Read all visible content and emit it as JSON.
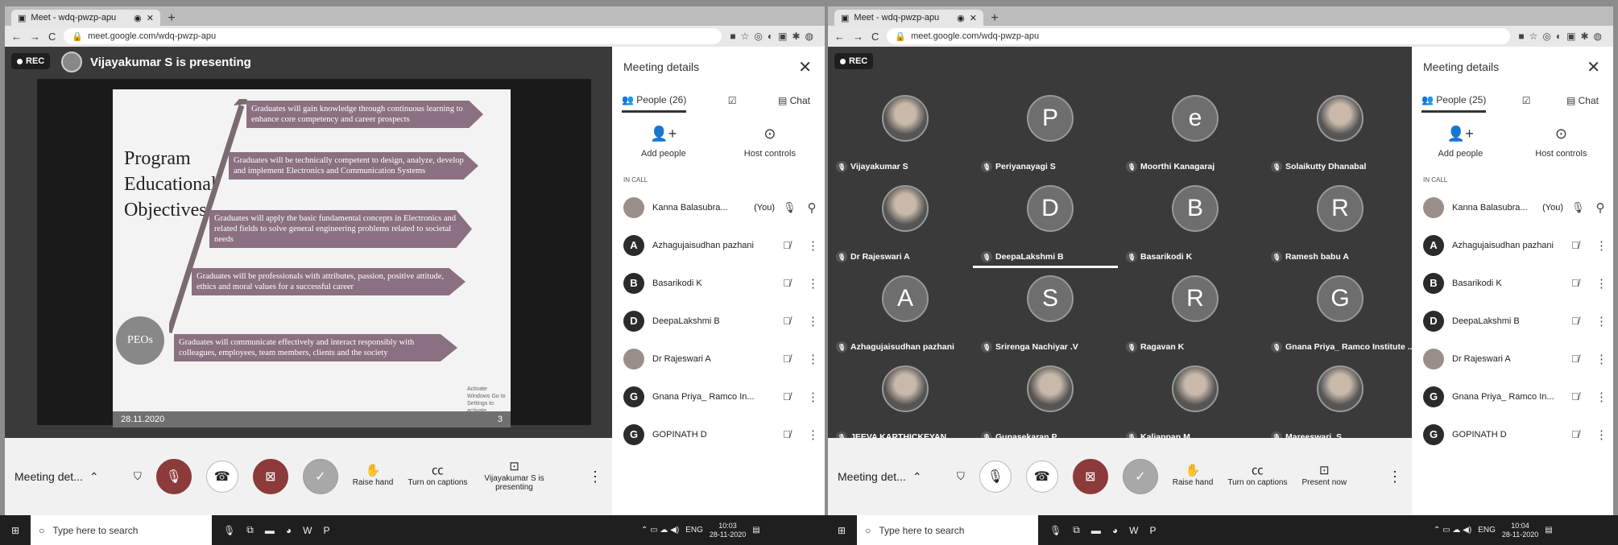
{
  "left": {
    "tab_title": "Meet - wdq-pwzp-apu",
    "url": "meet.google.com/wdq-pwzp-apu",
    "rec_label": "REC",
    "presenter_label": "Vijayakumar S is presenting",
    "slide": {
      "title": "Program Educational Objectives",
      "peo_label": "PEOs",
      "items": [
        "Graduates will gain knowledge through continuous learning to enhance core competency and career prospects",
        "Graduates will be technically competent to design, analyze, develop and implement Electronics and Communication Systems",
        "Graduates will apply the basic fundamental concepts in Electronics and related fields to solve general engineering problems related to societal needs",
        "Graduates will be professionals with attributes, passion, positive attitude, ethics and moral values for a successful career",
        "Graduates will communicate effectively and interact responsibly with colleagues, employees, team members, clients and the society"
      ],
      "date": "28.11.2020",
      "page": "3",
      "watermark": "Activate Windows Go to Settings to activate Windows."
    },
    "panel": {
      "title": "Meeting details",
      "people_tab": "People (26)",
      "chat_tab": "Chat",
      "add_people": "Add people",
      "host_controls": "Host controls",
      "in_call": "IN CALL",
      "people": [
        {
          "initial": "",
          "name": "Kanna Balasubra...",
          "you": "(You)",
          "photo": true
        },
        {
          "initial": "A",
          "name": "Azhagujaisudhan pazhani"
        },
        {
          "initial": "B",
          "name": "Basarikodi K"
        },
        {
          "initial": "D",
          "name": "DeepaLakshmi B"
        },
        {
          "initial": "",
          "name": "Dr Rajeswari A",
          "photo": true
        },
        {
          "initial": "G",
          "name": "Gnana Priya_ Ramco In..."
        },
        {
          "initial": "G",
          "name": "GOPINATH D"
        }
      ]
    },
    "controls": {
      "meeting_details": "Meeting det...",
      "raise_hand": "Raise hand",
      "captions": "Turn on captions",
      "presenting": "Vijayakumar S is presenting"
    }
  },
  "right": {
    "tab_title": "Meet - wdq-pwzp-apu",
    "url": "meet.google.com/wdq-pwzp-apu",
    "rec_label": "REC",
    "tiles": [
      {
        "initial": "",
        "name": "Vijayakumar S",
        "photo": true
      },
      {
        "initial": "P",
        "name": "Periyanayagi S"
      },
      {
        "initial": "e",
        "name": "Moorthi Kanagaraj"
      },
      {
        "initial": "",
        "name": "Solaikutty Dhanabal",
        "photo": true
      },
      {
        "initial": "",
        "name": "Dr Rajeswari A",
        "photo": true
      },
      {
        "initial": "D",
        "name": "DeepaLakshmi B"
      },
      {
        "initial": "B",
        "name": "Basarikodi K"
      },
      {
        "initial": "R",
        "name": "Ramesh babu A"
      },
      {
        "initial": "A",
        "name": "Azhagujaisudhan pazhani"
      },
      {
        "initial": "S",
        "name": "Srirenga Nachiyar .V"
      },
      {
        "initial": "R",
        "name": "Ragavan K"
      },
      {
        "initial": "G",
        "name": "Gnana Priya_ Ramco Institute ..."
      },
      {
        "initial": "",
        "name": "JEEVA KARTHICKEYAN",
        "photo": true
      },
      {
        "initial": "",
        "name": "Gunasekaran P",
        "photo": true
      },
      {
        "initial": "",
        "name": "Kaliappan M",
        "photo": true
      },
      {
        "initial": "",
        "name": "Mareeswari .S",
        "photo": true
      }
    ],
    "panel": {
      "title": "Meeting details",
      "people_tab": "People (25)",
      "chat_tab": "Chat",
      "add_people": "Add people",
      "host_controls": "Host controls",
      "in_call": "IN CALL",
      "people": [
        {
          "initial": "",
          "name": "Kanna Balasubra...",
          "you": "(You)",
          "photo": true
        },
        {
          "initial": "A",
          "name": "Azhagujaisudhan pazhani"
        },
        {
          "initial": "B",
          "name": "Basarikodi K"
        },
        {
          "initial": "D",
          "name": "DeepaLakshmi B"
        },
        {
          "initial": "",
          "name": "Dr Rajeswari A",
          "photo": true
        },
        {
          "initial": "G",
          "name": "Gnana Priya_ Ramco In..."
        },
        {
          "initial": "G",
          "name": "GOPINATH D"
        }
      ]
    },
    "controls": {
      "meeting_details": "Meeting det...",
      "raise_hand": "Raise hand",
      "captions": "Turn on captions",
      "present": "Present now"
    }
  },
  "taskbar": {
    "search_placeholder": "Type here to search",
    "left_time": "10:03",
    "left_date": "28-11-2020",
    "right_time": "10:04",
    "right_date": "28-11-2020",
    "lang": "ENG"
  }
}
